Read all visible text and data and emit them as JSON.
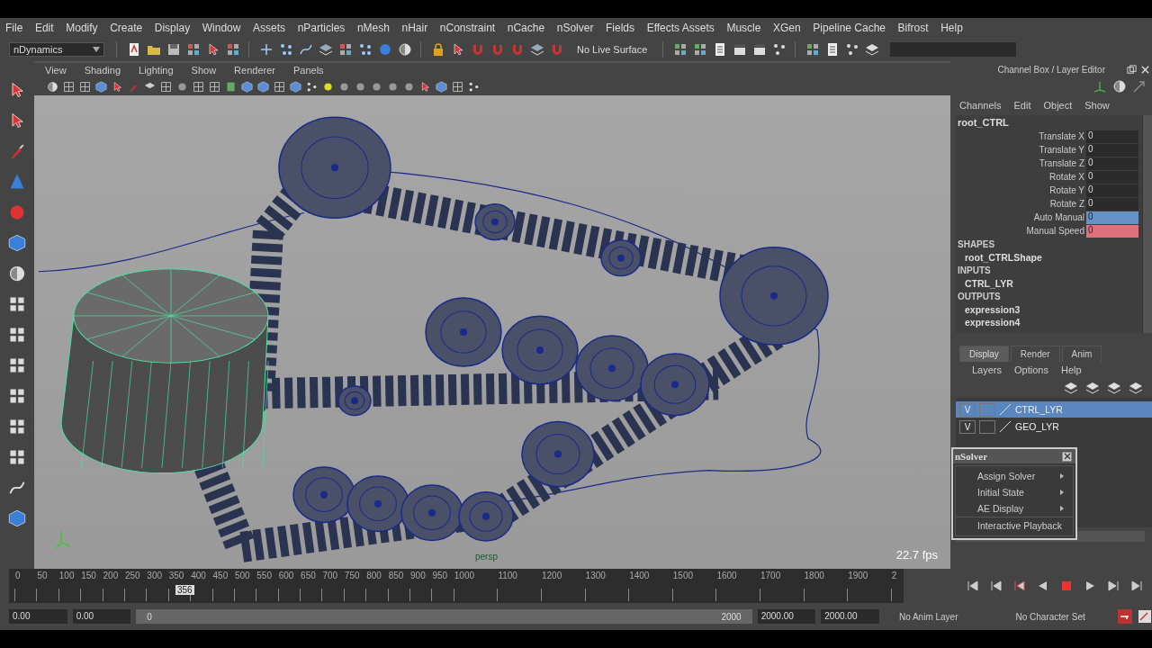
{
  "menubar": [
    "File",
    "Edit",
    "Modify",
    "Create",
    "Display",
    "Window",
    "Assets",
    "nParticles",
    "nMesh",
    "nHair",
    "nConstraint",
    "nCache",
    "nSolver",
    "Fields",
    "Effects Assets",
    "Muscle",
    "XGen",
    "Pipeline Cache",
    "Bifrost",
    "Help"
  ],
  "shelf": {
    "menu_set": "nDynamics",
    "live_surface": "No Live Surface"
  },
  "panel_menu": [
    "View",
    "Shading",
    "Lighting",
    "Show",
    "Renderer",
    "Panels"
  ],
  "viewport": {
    "camera": "persp",
    "fps": "22.7 fps"
  },
  "channel_box": {
    "title": "Channel Box / Layer Editor",
    "menus": [
      "Channels",
      "Edit",
      "Object",
      "Show"
    ],
    "object": "root_CTRL",
    "attributes": [
      {
        "name": "Translate X",
        "value": "0",
        "color": "#2b2b2b"
      },
      {
        "name": "Translate Y",
        "value": "0",
        "color": "#2b2b2b"
      },
      {
        "name": "Translate Z",
        "value": "0",
        "color": "#2b2b2b"
      },
      {
        "name": "Rotate X",
        "value": "0",
        "color": "#2b2b2b"
      },
      {
        "name": "Rotate Y",
        "value": "0",
        "color": "#2b2b2b"
      },
      {
        "name": "Rotate Z",
        "value": "0",
        "color": "#2b2b2b"
      },
      {
        "name": "Auto Manual",
        "value": "0",
        "color": "#6593c8"
      },
      {
        "name": "Manual Speed",
        "value": "0",
        "color": "#e0707a"
      }
    ],
    "sections": [
      {
        "heading": "SHAPES",
        "items": [
          "root_CTRLShape"
        ]
      },
      {
        "heading": "INPUTS",
        "items": [
          "CTRL_LYR"
        ]
      },
      {
        "heading": "OUTPUTS",
        "items": [
          "expression3",
          "expression4"
        ]
      }
    ]
  },
  "layer_editor": {
    "tabs": [
      {
        "label": "Display",
        "selected": true
      },
      {
        "label": "Render",
        "selected": false
      },
      {
        "label": "Anim",
        "selected": false
      }
    ],
    "menus": [
      "Layers",
      "Options",
      "Help"
    ],
    "layers": [
      {
        "visibility": "V",
        "name": "CTRL_LYR",
        "selected": true
      },
      {
        "visibility": "V",
        "name": "GEO_LYR",
        "selected": false
      }
    ]
  },
  "nsolver_menu": {
    "title": "nSolver",
    "items": [
      {
        "label": "Assign Solver",
        "kind": "submenu"
      },
      {
        "label": "Initial State",
        "kind": "submenu"
      },
      {
        "label": "AE Display",
        "kind": "submenu"
      },
      {
        "label": "Interactive Playback",
        "kind": "command"
      }
    ]
  },
  "timeline": {
    "ticks": [
      "0",
      "50",
      "100",
      "150",
      "200",
      "250",
      "300",
      "350",
      "400",
      "450",
      "500",
      "550",
      "600",
      "650",
      "700",
      "750",
      "800",
      "850",
      "900",
      "950",
      "1000",
      "1100",
      "1200",
      "1300",
      "1400",
      "1500",
      "1600",
      "1700",
      "1800",
      "1900",
      "2"
    ],
    "current_frame": {
      "label": "356",
      "level": 0.18
    }
  },
  "range": {
    "level": 1,
    "start": "0.00",
    "playback_start": "0.00",
    "slider_start": "0",
    "slider_end": "2000",
    "playback_end": "2000.00",
    "end": "2000.00"
  },
  "anim_layer": "No Anim Layer",
  "character_set": "No Character Set"
}
